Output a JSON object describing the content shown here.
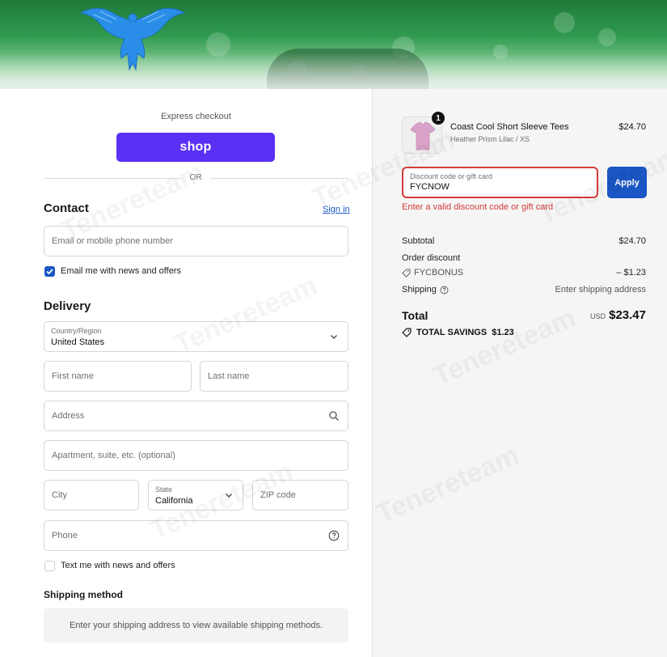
{
  "colors": {
    "shop_purple": "#5a31f4",
    "primary_blue": "#1a56c4",
    "error_red": "#d43b3b",
    "logo_blue": "#2a8ee8"
  },
  "watermark": "Tenereteam",
  "express": {
    "title": "Express checkout",
    "shop_label": "shop",
    "or_label": "OR"
  },
  "contact": {
    "heading": "Contact",
    "sign_in": "Sign in",
    "email_placeholder": "Email or mobile phone number",
    "email_optin_label": "Email me with news and offers",
    "email_optin_checked": true
  },
  "delivery": {
    "heading": "Delivery",
    "country_label": "Country/Region",
    "country_value": "United States",
    "first_name_placeholder": "First name",
    "last_name_placeholder": "Last name",
    "address_placeholder": "Address",
    "apartment_placeholder": "Apartment, suite, etc. (optional)",
    "city_placeholder": "City",
    "state_label": "State",
    "state_value": "California",
    "zip_placeholder": "ZIP code",
    "phone_placeholder": "Phone",
    "sms_optin_label": "Text me with news and offers",
    "sms_optin_checked": false
  },
  "shipping_method": {
    "heading": "Shipping method",
    "message": "Enter your shipping address to view available shipping methods."
  },
  "cart": {
    "item": {
      "quantity": "1",
      "name": "Coast Cool Short Sleeve Tees",
      "variant": "Heather Prism Lilac / XS",
      "price": "$24.70"
    },
    "discount": {
      "label": "Discount code or gift card",
      "value": "FYCNOW",
      "apply_label": "Apply",
      "error": "Enter a valid discount code or gift card"
    },
    "summary": {
      "subtotal_label": "Subtotal",
      "subtotal_value": "$24.70",
      "order_discount_label": "Order discount",
      "discount_code": "FYCBONUS",
      "discount_value": "– $1.23",
      "shipping_label": "Shipping",
      "shipping_value": "Enter shipping address",
      "total_label": "Total",
      "currency": "USD",
      "total_value": "$23.47",
      "savings_label": "TOTAL SAVINGS",
      "savings_value": "$1.23"
    }
  }
}
